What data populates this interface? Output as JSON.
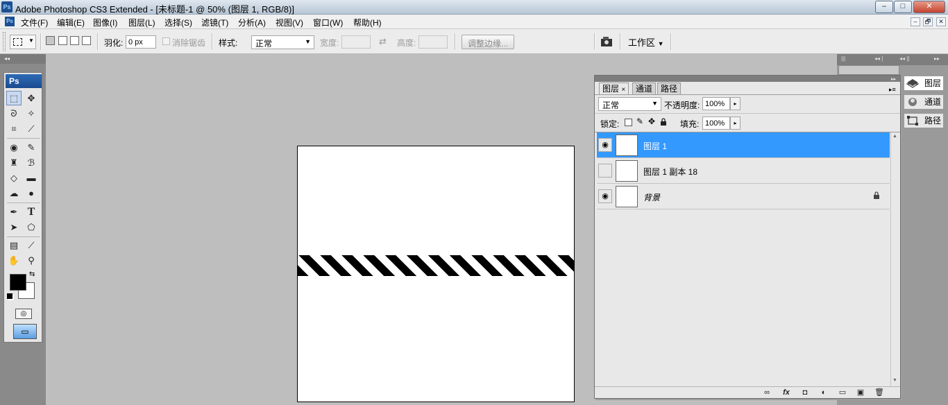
{
  "window": {
    "title": "Adobe Photoshop CS3 Extended - [未标题-1 @ 50% (图层 1, RGB/8)]",
    "logo": "Ps",
    "minimize": "–",
    "maximize": "□",
    "close": "✕"
  },
  "menu": {
    "items": [
      "文件(F)",
      "编辑(E)",
      "图像(I)",
      "图层(L)",
      "选择(S)",
      "滤镜(T)",
      "分析(A)",
      "视图(V)",
      "窗口(W)",
      "帮助(H)"
    ],
    "mdi_min": "–",
    "mdi_restore": "🗗",
    "mdi_close": "✕"
  },
  "options": {
    "feather_label": "羽化:",
    "feather_value": "0 px",
    "antialias_label": "消除锯齿",
    "style_label": "样式:",
    "style_value": "正常",
    "width_label": "宽度:",
    "height_label": "高度:",
    "refine_edge": "调整边缘...",
    "workspace": "工作区"
  },
  "toolbox": {
    "header": "Ps",
    "tools": [
      {
        "name": "marquee-tool",
        "glyph": "⬚"
      },
      {
        "name": "move-tool",
        "glyph": "✥"
      },
      {
        "name": "lasso-tool",
        "glyph": "ᘐ"
      },
      {
        "name": "magic-wand-tool",
        "glyph": "✧"
      },
      {
        "name": "crop-tool",
        "glyph": "⌗"
      },
      {
        "name": "slice-tool",
        "glyph": "⟋"
      },
      {
        "name": "healing-tool",
        "glyph": "◉"
      },
      {
        "name": "brush-tool",
        "glyph": "✎"
      },
      {
        "name": "clone-stamp-tool",
        "glyph": "♜"
      },
      {
        "name": "history-brush-tool",
        "glyph": "ℬ"
      },
      {
        "name": "eraser-tool",
        "glyph": "◇"
      },
      {
        "name": "gradient-tool",
        "glyph": "▬"
      },
      {
        "name": "blur-tool",
        "glyph": "☁"
      },
      {
        "name": "dodge-tool",
        "glyph": "●"
      },
      {
        "name": "pen-tool",
        "glyph": "✒"
      },
      {
        "name": "type-tool",
        "glyph": "T"
      },
      {
        "name": "path-selection-tool",
        "glyph": "➤"
      },
      {
        "name": "shape-tool",
        "glyph": "⬠"
      },
      {
        "name": "notes-tool",
        "glyph": "▤"
      },
      {
        "name": "eyedropper-tool",
        "glyph": "⟋"
      },
      {
        "name": "hand-tool",
        "glyph": "✋"
      },
      {
        "name": "zoom-tool",
        "glyph": "⚲"
      }
    ],
    "swap_glyph": "⇆",
    "quickmask_glyph": "◎",
    "screenmode_glyph": "▭"
  },
  "colors": {
    "foreground": "#000000",
    "background": "#ffffff",
    "selection": "#3399ff"
  },
  "layers_panel": {
    "tabs": [
      "图层",
      "通道",
      "路径"
    ],
    "tab_close": "×",
    "blend_mode": "正常",
    "opacity_label": "不透明度:",
    "opacity_value": "100%",
    "lock_label": "锁定:",
    "fill_label": "填充:",
    "fill_value": "100%",
    "layers": [
      {
        "name": "图层 1",
        "visible": true,
        "selected": true,
        "thumb": "checker"
      },
      {
        "name": "图层 1 副本 18",
        "visible": false,
        "selected": false,
        "thumb": "hatch"
      },
      {
        "name": "背景",
        "visible": true,
        "selected": false,
        "thumb": "white",
        "locked": true
      }
    ],
    "eye_glyph": "◉",
    "lock_glyph": "🔒",
    "footer": [
      "∞",
      "fx",
      "◘",
      "◐",
      "▭",
      "▣",
      "🗑"
    ]
  },
  "dock": {
    "tabs": [
      "图层",
      "通道",
      "路径"
    ]
  }
}
